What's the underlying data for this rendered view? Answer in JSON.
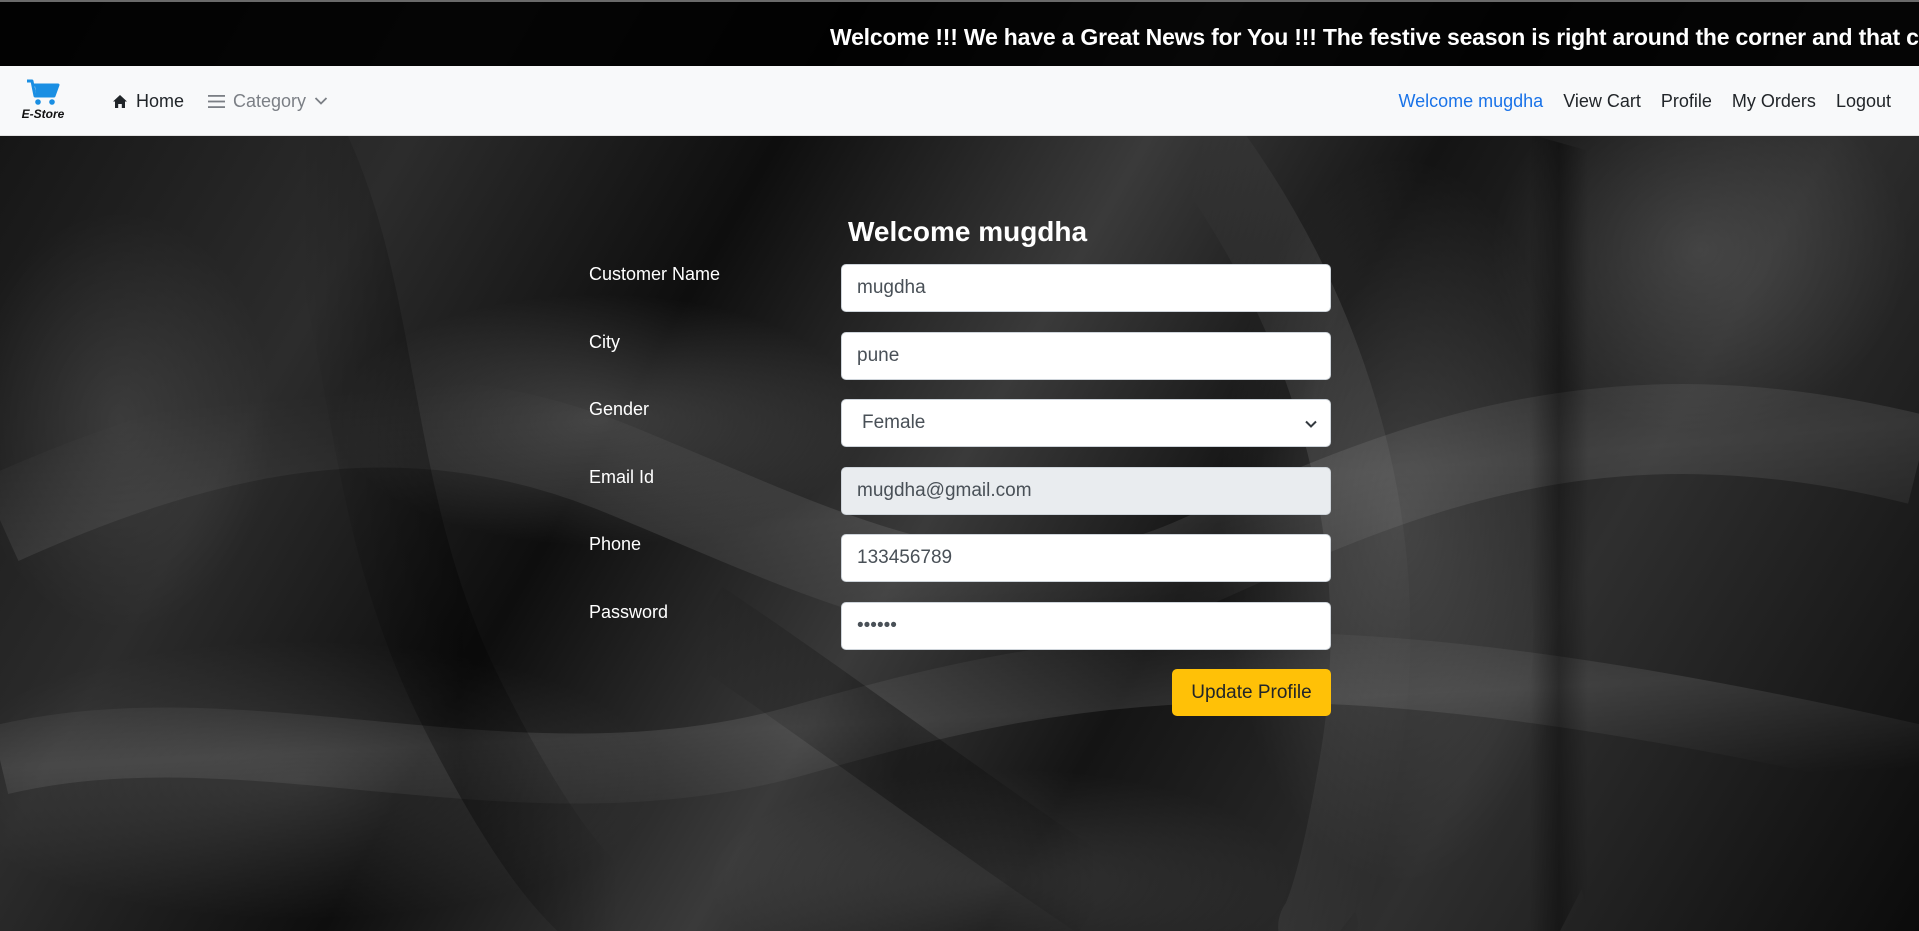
{
  "marquee": {
    "text": "Welcome !!! We have a Great News for You !!! The festive season is right around the corner and that can only"
  },
  "navbar": {
    "brand": {
      "icon": "shopping-cart-icon",
      "label": "E-Store",
      "icon_color": "#1a8fe3"
    },
    "home": {
      "icon": "home-icon",
      "label": "Home"
    },
    "category": {
      "icon": "menu-icon",
      "label": "Category",
      "caret": "chevron-down-icon"
    },
    "right_links": [
      {
        "label": "Welcome mugdha",
        "active": true
      },
      {
        "label": "View Cart"
      },
      {
        "label": "Profile"
      },
      {
        "label": "My Orders"
      },
      {
        "label": "Logout"
      }
    ]
  },
  "form": {
    "title": "Welcome mugdha",
    "fields": {
      "customer_name": {
        "label": "Customer Name",
        "value": "mugdha"
      },
      "city": {
        "label": "City",
        "value": "pune"
      },
      "gender": {
        "label": "Gender",
        "value": "Female"
      },
      "email": {
        "label": "Email Id",
        "value": "mugdha@gmail.com",
        "readonly": true
      },
      "phone": {
        "label": "Phone",
        "value": "133456789"
      },
      "password": {
        "label": "Password",
        "value": "••••••"
      }
    },
    "submit_label": "Update Profile"
  },
  "colors": {
    "accent_link": "#1a73e8",
    "button": "#ffc107",
    "navbar_bg": "#f8f9fa"
  }
}
